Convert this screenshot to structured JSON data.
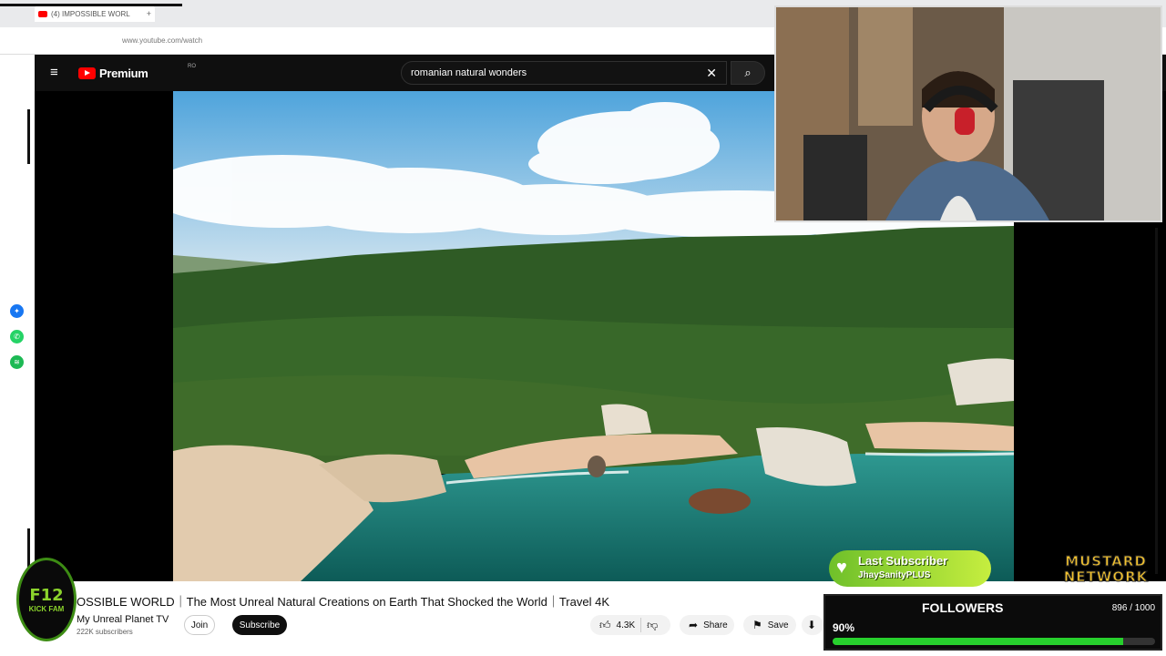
{
  "browser": {
    "tab_title": "(4) IMPOSSIBLE WORL",
    "tab_close": "+",
    "url": "www.youtube.com/watch"
  },
  "youtube": {
    "logo_text": "Premium",
    "logo_region": "RO",
    "search_query": "romanian natural wonders",
    "search_clear": "✕",
    "search_icon": "⌕"
  },
  "video": {
    "title": "OSSIBLE WORLD｜The Most Unreal Natural Creations on Earth That Shocked the World｜Travel 4K",
    "channel": "My Unreal Planet TV",
    "subscribers": "222K subscribers",
    "join_label": "Join",
    "subscribe_label": "Subscribe",
    "like_count": "4.3K",
    "share_label": "Share",
    "save_label": "Save"
  },
  "overlays": {
    "kick_top": "F12",
    "kick_bottom": "KICK FAM",
    "last_subscriber_title": "Last Subscriber",
    "last_subscriber_name": "JhaySanityPLUS",
    "brand_line1": "MUSTARD",
    "brand_line2": "NETWORK",
    "followers_title": "FOLLOWERS",
    "followers_count": "896 / 1000",
    "followers_percent_label": "90%",
    "followers_progress": 0.9
  },
  "colors": {
    "youtube_red": "#ff0000",
    "follower_bar": "#27d02d",
    "subscriber_green": "#8bd32c"
  }
}
